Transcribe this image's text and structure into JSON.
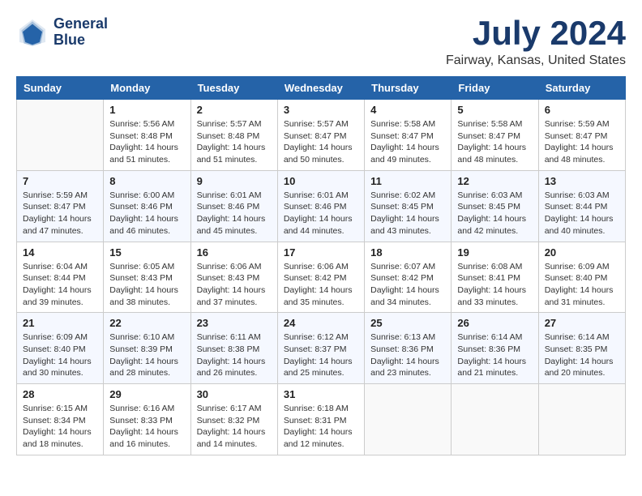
{
  "logo": {
    "text_line1": "General",
    "text_line2": "Blue"
  },
  "title": {
    "month_year": "July 2024",
    "location": "Fairway, Kansas, United States"
  },
  "days_of_week": [
    "Sunday",
    "Monday",
    "Tuesday",
    "Wednesday",
    "Thursday",
    "Friday",
    "Saturday"
  ],
  "weeks": [
    [
      {
        "day": "",
        "sunrise": "",
        "sunset": "",
        "daylight": ""
      },
      {
        "day": "1",
        "sunrise": "Sunrise: 5:56 AM",
        "sunset": "Sunset: 8:48 PM",
        "daylight": "Daylight: 14 hours and 51 minutes."
      },
      {
        "day": "2",
        "sunrise": "Sunrise: 5:57 AM",
        "sunset": "Sunset: 8:48 PM",
        "daylight": "Daylight: 14 hours and 51 minutes."
      },
      {
        "day": "3",
        "sunrise": "Sunrise: 5:57 AM",
        "sunset": "Sunset: 8:47 PM",
        "daylight": "Daylight: 14 hours and 50 minutes."
      },
      {
        "day": "4",
        "sunrise": "Sunrise: 5:58 AM",
        "sunset": "Sunset: 8:47 PM",
        "daylight": "Daylight: 14 hours and 49 minutes."
      },
      {
        "day": "5",
        "sunrise": "Sunrise: 5:58 AM",
        "sunset": "Sunset: 8:47 PM",
        "daylight": "Daylight: 14 hours and 48 minutes."
      },
      {
        "day": "6",
        "sunrise": "Sunrise: 5:59 AM",
        "sunset": "Sunset: 8:47 PM",
        "daylight": "Daylight: 14 hours and 48 minutes."
      }
    ],
    [
      {
        "day": "7",
        "sunrise": "Sunrise: 5:59 AM",
        "sunset": "Sunset: 8:47 PM",
        "daylight": "Daylight: 14 hours and 47 minutes."
      },
      {
        "day": "8",
        "sunrise": "Sunrise: 6:00 AM",
        "sunset": "Sunset: 8:46 PM",
        "daylight": "Daylight: 14 hours and 46 minutes."
      },
      {
        "day": "9",
        "sunrise": "Sunrise: 6:01 AM",
        "sunset": "Sunset: 8:46 PM",
        "daylight": "Daylight: 14 hours and 45 minutes."
      },
      {
        "day": "10",
        "sunrise": "Sunrise: 6:01 AM",
        "sunset": "Sunset: 8:46 PM",
        "daylight": "Daylight: 14 hours and 44 minutes."
      },
      {
        "day": "11",
        "sunrise": "Sunrise: 6:02 AM",
        "sunset": "Sunset: 8:45 PM",
        "daylight": "Daylight: 14 hours and 43 minutes."
      },
      {
        "day": "12",
        "sunrise": "Sunrise: 6:03 AM",
        "sunset": "Sunset: 8:45 PM",
        "daylight": "Daylight: 14 hours and 42 minutes."
      },
      {
        "day": "13",
        "sunrise": "Sunrise: 6:03 AM",
        "sunset": "Sunset: 8:44 PM",
        "daylight": "Daylight: 14 hours and 40 minutes."
      }
    ],
    [
      {
        "day": "14",
        "sunrise": "Sunrise: 6:04 AM",
        "sunset": "Sunset: 8:44 PM",
        "daylight": "Daylight: 14 hours and 39 minutes."
      },
      {
        "day": "15",
        "sunrise": "Sunrise: 6:05 AM",
        "sunset": "Sunset: 8:43 PM",
        "daylight": "Daylight: 14 hours and 38 minutes."
      },
      {
        "day": "16",
        "sunrise": "Sunrise: 6:06 AM",
        "sunset": "Sunset: 8:43 PM",
        "daylight": "Daylight: 14 hours and 37 minutes."
      },
      {
        "day": "17",
        "sunrise": "Sunrise: 6:06 AM",
        "sunset": "Sunset: 8:42 PM",
        "daylight": "Daylight: 14 hours and 35 minutes."
      },
      {
        "day": "18",
        "sunrise": "Sunrise: 6:07 AM",
        "sunset": "Sunset: 8:42 PM",
        "daylight": "Daylight: 14 hours and 34 minutes."
      },
      {
        "day": "19",
        "sunrise": "Sunrise: 6:08 AM",
        "sunset": "Sunset: 8:41 PM",
        "daylight": "Daylight: 14 hours and 33 minutes."
      },
      {
        "day": "20",
        "sunrise": "Sunrise: 6:09 AM",
        "sunset": "Sunset: 8:40 PM",
        "daylight": "Daylight: 14 hours and 31 minutes."
      }
    ],
    [
      {
        "day": "21",
        "sunrise": "Sunrise: 6:09 AM",
        "sunset": "Sunset: 8:40 PM",
        "daylight": "Daylight: 14 hours and 30 minutes."
      },
      {
        "day": "22",
        "sunrise": "Sunrise: 6:10 AM",
        "sunset": "Sunset: 8:39 PM",
        "daylight": "Daylight: 14 hours and 28 minutes."
      },
      {
        "day": "23",
        "sunrise": "Sunrise: 6:11 AM",
        "sunset": "Sunset: 8:38 PM",
        "daylight": "Daylight: 14 hours and 26 minutes."
      },
      {
        "day": "24",
        "sunrise": "Sunrise: 6:12 AM",
        "sunset": "Sunset: 8:37 PM",
        "daylight": "Daylight: 14 hours and 25 minutes."
      },
      {
        "day": "25",
        "sunrise": "Sunrise: 6:13 AM",
        "sunset": "Sunset: 8:36 PM",
        "daylight": "Daylight: 14 hours and 23 minutes."
      },
      {
        "day": "26",
        "sunrise": "Sunrise: 6:14 AM",
        "sunset": "Sunset: 8:36 PM",
        "daylight": "Daylight: 14 hours and 21 minutes."
      },
      {
        "day": "27",
        "sunrise": "Sunrise: 6:14 AM",
        "sunset": "Sunset: 8:35 PM",
        "daylight": "Daylight: 14 hours and 20 minutes."
      }
    ],
    [
      {
        "day": "28",
        "sunrise": "Sunrise: 6:15 AM",
        "sunset": "Sunset: 8:34 PM",
        "daylight": "Daylight: 14 hours and 18 minutes."
      },
      {
        "day": "29",
        "sunrise": "Sunrise: 6:16 AM",
        "sunset": "Sunset: 8:33 PM",
        "daylight": "Daylight: 14 hours and 16 minutes."
      },
      {
        "day": "30",
        "sunrise": "Sunrise: 6:17 AM",
        "sunset": "Sunset: 8:32 PM",
        "daylight": "Daylight: 14 hours and 14 minutes."
      },
      {
        "day": "31",
        "sunrise": "Sunrise: 6:18 AM",
        "sunset": "Sunset: 8:31 PM",
        "daylight": "Daylight: 14 hours and 12 minutes."
      },
      {
        "day": "",
        "sunrise": "",
        "sunset": "",
        "daylight": ""
      },
      {
        "day": "",
        "sunrise": "",
        "sunset": "",
        "daylight": ""
      },
      {
        "day": "",
        "sunrise": "",
        "sunset": "",
        "daylight": ""
      }
    ]
  ]
}
